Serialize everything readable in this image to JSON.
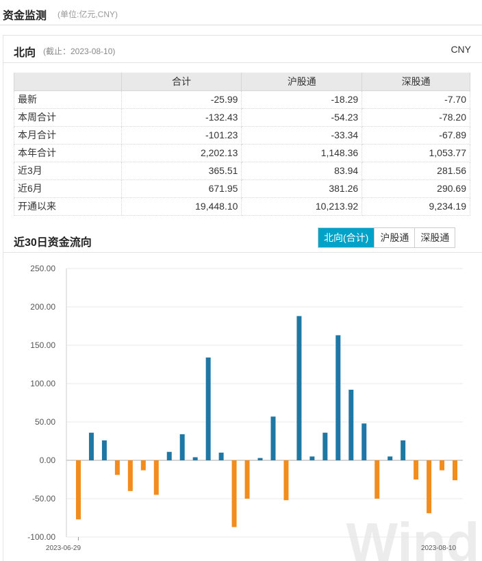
{
  "header": {
    "title": "资金监测",
    "unit": "(单位:亿元,CNY)"
  },
  "panel": {
    "title": "北向",
    "date": "(截止：2023-08-10)",
    "currency": "CNY"
  },
  "table": {
    "columns": [
      "",
      "合计",
      "沪股通",
      "深股通"
    ],
    "rows": [
      [
        "最新",
        "-25.99",
        "-18.29",
        "-7.70"
      ],
      [
        "本周合计",
        "-132.43",
        "-54.23",
        "-78.20"
      ],
      [
        "本月合计",
        "-101.23",
        "-33.34",
        "-67.89"
      ],
      [
        "本年合计",
        "2,202.13",
        "1,148.36",
        "1,053.77"
      ],
      [
        "近3月",
        "365.51",
        "83.94",
        "281.56"
      ],
      [
        "近6月",
        "671.95",
        "381.26",
        "290.69"
      ],
      [
        "开通以来",
        "19,448.10",
        "10,213.92",
        "9,234.19"
      ]
    ]
  },
  "flow_section": {
    "title": "近30日资金流向",
    "tabs": [
      {
        "label": "北向(合计)",
        "active": true
      },
      {
        "label": "沪股通",
        "active": false
      },
      {
        "label": "深股通",
        "active": false
      }
    ]
  },
  "chart_data": {
    "type": "bar",
    "x_first": "2023-06-29",
    "x_last": "2023-08-10",
    "values": [
      -77,
      36,
      26,
      -19,
      -40,
      -13,
      -45,
      11,
      34,
      4,
      134,
      10,
      -87,
      -50,
      3,
      57,
      -52,
      188,
      5,
      36,
      163,
      92,
      48,
      -50,
      5,
      26,
      -25,
      -69,
      -13,
      -26
    ],
    "ylim": [
      -100,
      250
    ],
    "yticks": [
      "250.00",
      "200.00",
      "150.00",
      "100.00",
      "50.00",
      "0.00",
      "-50.00",
      "-100.00"
    ],
    "grid": true,
    "colors": {
      "positive": "#1f77a4",
      "negative": "#f28c1c"
    },
    "watermark": "Wind"
  }
}
